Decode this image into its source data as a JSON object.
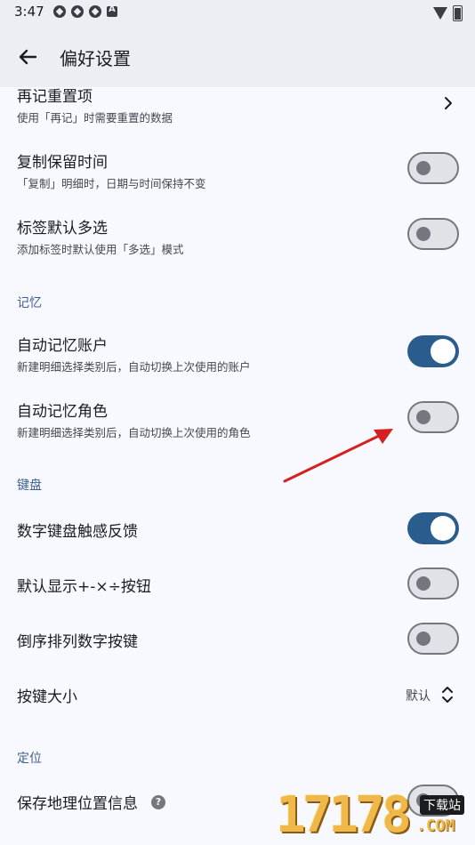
{
  "status": {
    "time": "3:47"
  },
  "header": {
    "title": "偏好设置"
  },
  "rows": [
    {
      "title": "再记重置项",
      "sub": "使用「再记」时需要重置的数据"
    },
    {
      "title": "复制保留时间",
      "sub": "「复制」明细时，日期与时间保持不变",
      "toggle": false
    },
    {
      "title": "标签默认多选",
      "sub": "添加标签时默认使用「多选」模式",
      "toggle": false
    }
  ],
  "sections": {
    "memory": "记忆",
    "keyboard": "键盘",
    "location": "定位"
  },
  "memory_rows": [
    {
      "title": "自动记忆账户",
      "sub": "新建明细选择类别后，自动切换上次使用的账户",
      "toggle": true
    },
    {
      "title": "自动记忆角色",
      "sub": "新建明细选择类别后，自动切换上次使用的角色",
      "toggle": false
    }
  ],
  "keyboard_rows": [
    {
      "title": "数字键盘触感反馈",
      "toggle": true
    },
    {
      "title": "默认显示+-×÷按钮",
      "toggle": false
    },
    {
      "title": "倒序排列数字按键",
      "toggle": false
    },
    {
      "title": "按键大小",
      "value": "默认"
    }
  ],
  "location_rows": [
    {
      "title": "保存地理位置信息",
      "help": "?",
      "toggle": false
    }
  ],
  "watermark": {
    "number": "17178",
    "badge": "下载站",
    "suffix": ".COM"
  },
  "colors": {
    "accent": "#2a5d8e",
    "section": "#3f5f90",
    "arrow": "#d42020"
  }
}
